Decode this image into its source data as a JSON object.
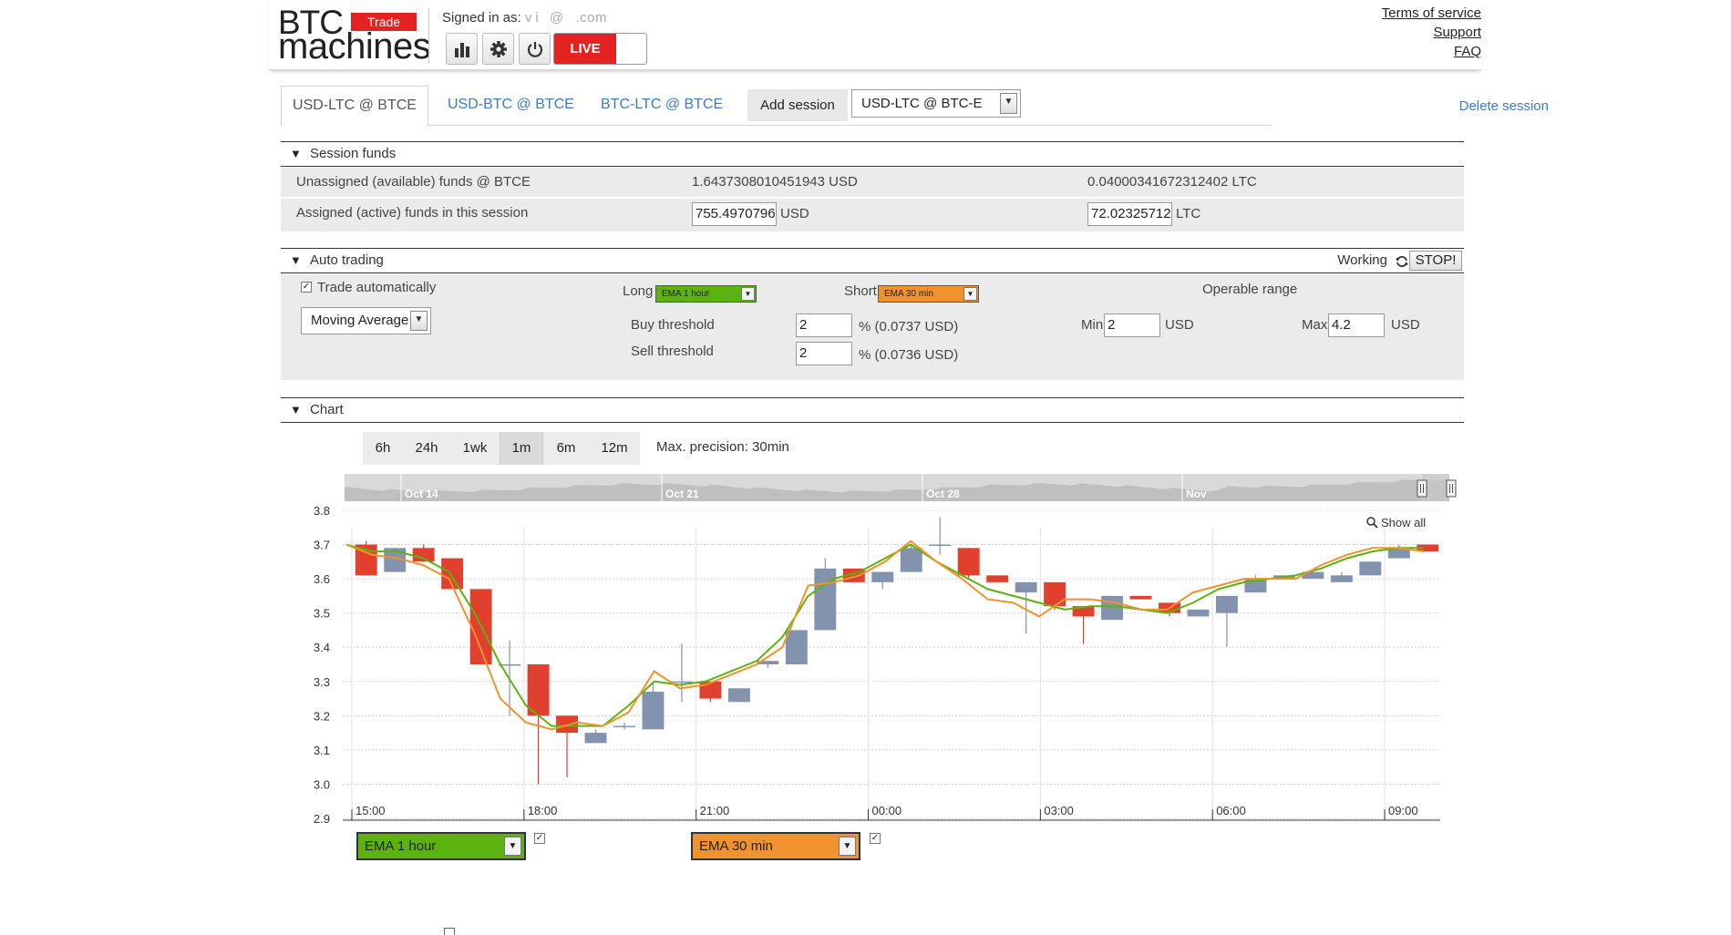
{
  "header": {
    "logo_btc": "BTC",
    "logo_machines": "machines",
    "logo_badge": "Trade",
    "signed_in_label": "Signed in as:",
    "signed_in_user": "v i    @    .com",
    "live_label": "LIVE",
    "links": [
      "Terms of service",
      "Support",
      "FAQ"
    ]
  },
  "tabs": [
    {
      "label": "USD-LTC @ BTCE",
      "active": true
    },
    {
      "label": "USD-BTC @ BTCE",
      "active": false
    },
    {
      "label": "BTC-LTC @ BTCE",
      "active": false
    }
  ],
  "add_session": {
    "button": "Add session",
    "selected": "USD-LTC @ BTC-E"
  },
  "delete_session": "Delete session",
  "session_funds": {
    "title": "Session funds",
    "unassigned_label": "Unassigned (available) funds @ BTCE",
    "unassigned_usd": "1.6437308010451943 USD",
    "unassigned_ltc": "0.04000341672312402 LTC",
    "assigned_label": "Assigned (active) funds in this session",
    "assigned_usd_value": "755.4970796",
    "assigned_usd_unit": "USD",
    "assigned_ltc_value": "72.02325712",
    "assigned_ltc_unit": "LTC"
  },
  "auto_trading": {
    "title": "Auto trading",
    "status": "Working",
    "stop_label": "STOP!",
    "trade_auto_label": "Trade automatically",
    "trade_auto_checked": true,
    "strategy": "Moving Average",
    "long_label": "Long",
    "long_value": "EMA 1 hour",
    "short_label": "Short",
    "short_value": "EMA 30 min",
    "buy_threshold_label": "Buy threshold",
    "buy_threshold_value": "2",
    "buy_threshold_info": "% (0.0737 USD)",
    "sell_threshold_label": "Sell threshold",
    "sell_threshold_value": "2",
    "sell_threshold_info": "% (0.0736 USD)",
    "operable_range_label": "Operable range",
    "min_label": "Min",
    "min_value": "2",
    "min_unit": "USD",
    "max_label": "Max",
    "max_value": "4.2",
    "max_unit": "USD"
  },
  "chart_section": {
    "title": "Chart",
    "ranges": [
      "6h",
      "24h",
      "1wk",
      "1m",
      "6m",
      "12m"
    ],
    "active_range": "1m",
    "precision": "Max. precision: 30min",
    "navigator_labels": [
      "Oct 14",
      "Oct 21",
      "Oct 28",
      "Nov"
    ],
    "show_all": "Show all",
    "legend": [
      {
        "label": "EMA 1 hour",
        "color": "#5cb30f",
        "checked": true
      },
      {
        "label": "EMA 30 min",
        "color": "#f0922d",
        "checked": true
      }
    ]
  },
  "colors": {
    "accent_red": "#e52222",
    "link_blue": "#3b7cc4",
    "candle_up": "#8392ad",
    "candle_down": "#e2402f",
    "ema_long": "#5cb30f",
    "ema_short": "#f0922d"
  },
  "chart_data": {
    "type": "candlestick",
    "x": [
      "15:00",
      "15:30",
      "16:00",
      "16:30",
      "17:00",
      "17:30",
      "18:00",
      "18:30",
      "19:00",
      "19:30",
      "20:00",
      "20:30",
      "21:00",
      "21:30",
      "22:00",
      "22:30",
      "23:00",
      "23:30",
      "00:00",
      "00:30",
      "01:00",
      "01:30",
      "02:00",
      "02:30",
      "03:00",
      "03:30",
      "04:00",
      "04:30",
      "05:00",
      "05:30",
      "06:00",
      "06:30",
      "07:00",
      "07:30",
      "08:00",
      "08:30",
      "09:00",
      "09:30",
      "10:00",
      "10:30"
    ],
    "xticks": [
      "15:00",
      "18:00",
      "21:00",
      "00:00",
      "03:00",
      "06:00",
      "09:00"
    ],
    "ylim": [
      2.9,
      3.8
    ],
    "yticks": [
      2.9,
      3.0,
      3.1,
      3.2,
      3.3,
      3.4,
      3.5,
      3.6,
      3.7,
      3.8
    ],
    "candles": [
      {
        "o": 3.7,
        "h": 3.71,
        "l": 3.61,
        "c": 3.61
      },
      {
        "o": 3.62,
        "h": 3.69,
        "l": 3.62,
        "c": 3.69
      },
      {
        "o": 3.69,
        "h": 3.7,
        "l": 3.65,
        "c": 3.65
      },
      {
        "o": 3.66,
        "h": 3.66,
        "l": 3.57,
        "c": 3.57
      },
      {
        "o": 3.57,
        "h": 3.57,
        "l": 3.35,
        "c": 3.35
      },
      {
        "o": 3.35,
        "h": 3.42,
        "l": 3.2,
        "c": 3.35
      },
      {
        "o": 3.35,
        "h": 3.35,
        "l": 3.0,
        "c": 3.2
      },
      {
        "o": 3.2,
        "h": 3.2,
        "l": 3.02,
        "c": 3.15
      },
      {
        "o": 3.12,
        "h": 3.16,
        "l": 3.12,
        "c": 3.15
      },
      {
        "o": 3.17,
        "h": 3.18,
        "l": 3.16,
        "c": 3.17
      },
      {
        "o": 3.16,
        "h": 3.3,
        "l": 3.16,
        "c": 3.27
      },
      {
        "o": 3.3,
        "h": 3.41,
        "l": 3.24,
        "c": 3.3
      },
      {
        "o": 3.3,
        "h": 3.3,
        "l": 3.24,
        "c": 3.25
      },
      {
        "o": 3.24,
        "h": 3.28,
        "l": 3.24,
        "c": 3.28
      },
      {
        "o": 3.35,
        "h": 3.36,
        "l": 3.34,
        "c": 3.36
      },
      {
        "o": 3.35,
        "h": 3.45,
        "l": 3.35,
        "c": 3.45
      },
      {
        "o": 3.45,
        "h": 3.66,
        "l": 3.45,
        "c": 3.63
      },
      {
        "o": 3.63,
        "h": 3.63,
        "l": 3.59,
        "c": 3.59
      },
      {
        "o": 3.59,
        "h": 3.62,
        "l": 3.57,
        "c": 3.62
      },
      {
        "o": 3.62,
        "h": 3.7,
        "l": 3.62,
        "c": 3.69
      },
      {
        "o": 3.7,
        "h": 3.78,
        "l": 3.67,
        "c": 3.7
      },
      {
        "o": 3.69,
        "h": 3.69,
        "l": 3.6,
        "c": 3.61
      },
      {
        "o": 3.61,
        "h": 3.61,
        "l": 3.59,
        "c": 3.59
      },
      {
        "o": 3.56,
        "h": 3.59,
        "l": 3.44,
        "c": 3.59
      },
      {
        "o": 3.59,
        "h": 3.59,
        "l": 3.51,
        "c": 3.52
      },
      {
        "o": 3.52,
        "h": 3.52,
        "l": 3.41,
        "c": 3.49
      },
      {
        "o": 3.48,
        "h": 3.55,
        "l": 3.48,
        "c": 3.55
      },
      {
        "o": 3.55,
        "h": 3.55,
        "l": 3.54,
        "c": 3.54
      },
      {
        "o": 3.53,
        "h": 3.53,
        "l": 3.49,
        "c": 3.5
      },
      {
        "o": 3.49,
        "h": 3.51,
        "l": 3.49,
        "c": 3.51
      },
      {
        "o": 3.5,
        "h": 3.55,
        "l": 3.4,
        "c": 3.55
      },
      {
        "o": 3.56,
        "h": 3.61,
        "l": 3.56,
        "c": 3.6
      },
      {
        "o": 3.6,
        "h": 3.61,
        "l": 3.6,
        "c": 3.61
      },
      {
        "o": 3.6,
        "h": 3.62,
        "l": 3.6,
        "c": 3.62
      },
      {
        "o": 3.59,
        "h": 3.62,
        "l": 3.59,
        "c": 3.61
      },
      {
        "o": 3.61,
        "h": 3.65,
        "l": 3.61,
        "c": 3.65
      },
      {
        "o": 3.66,
        "h": 3.7,
        "l": 3.66,
        "c": 3.69
      },
      {
        "o": 3.7,
        "h": 3.7,
        "l": 3.68,
        "c": 3.68
      }
    ],
    "series": [
      {
        "name": "EMA 1 hour",
        "values": [
          3.7,
          3.68,
          3.68,
          3.66,
          3.62,
          3.5,
          3.35,
          3.23,
          3.17,
          3.17,
          3.17,
          3.23,
          3.3,
          3.29,
          3.3,
          3.33,
          3.36,
          3.43,
          3.55,
          3.6,
          3.62,
          3.66,
          3.7,
          3.65,
          3.61,
          3.57,
          3.55,
          3.53,
          3.51,
          3.52,
          3.52,
          3.51,
          3.5,
          3.53,
          3.57,
          3.59,
          3.6,
          3.61,
          3.63,
          3.66,
          3.68,
          3.69,
          3.69
        ]
      },
      {
        "name": "EMA 30 min",
        "values": [
          3.7,
          3.67,
          3.66,
          3.64,
          3.6,
          3.44,
          3.25,
          3.18,
          3.16,
          3.18,
          3.17,
          3.21,
          3.33,
          3.28,
          3.29,
          3.32,
          3.35,
          3.4,
          3.58,
          3.59,
          3.61,
          3.65,
          3.71,
          3.65,
          3.6,
          3.54,
          3.53,
          3.49,
          3.54,
          3.54,
          3.53,
          3.51,
          3.51,
          3.56,
          3.58,
          3.6,
          3.6,
          3.6,
          3.64,
          3.67,
          3.69,
          3.69,
          3.68
        ]
      }
    ]
  }
}
